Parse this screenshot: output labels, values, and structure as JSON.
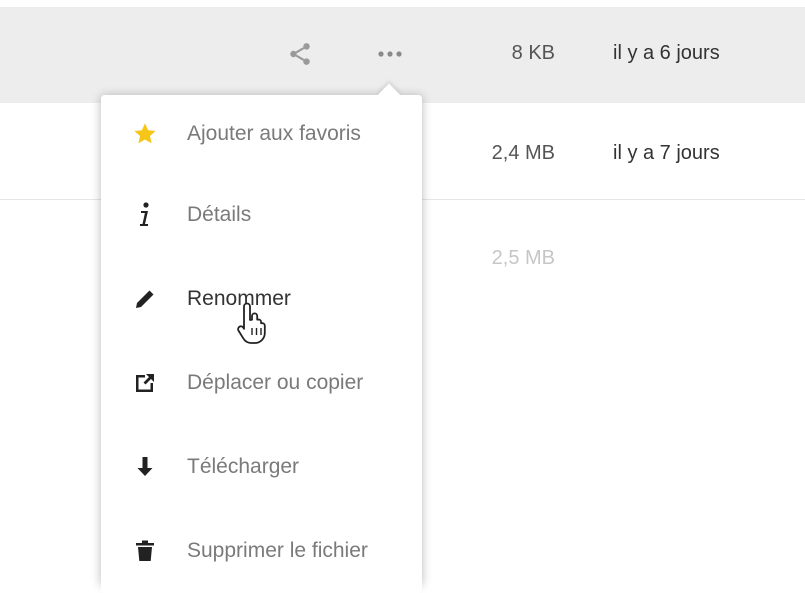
{
  "rows": [
    {
      "size": "8 KB",
      "date": "il y a 6 jours"
    },
    {
      "size": "2,4 MB",
      "date": "il y a 7 jours"
    },
    {
      "size": "2,5 MB"
    }
  ],
  "row_actions": {
    "share_icon": "share-icon",
    "more_icon": "more-horizontal-icon"
  },
  "menu": {
    "items": [
      {
        "label": "Ajouter aux favoris",
        "icon": "star-icon"
      },
      {
        "label": "Détails",
        "icon": "info-icon"
      },
      {
        "label": "Renommer",
        "icon": "pencil-icon"
      },
      {
        "label": "Déplacer ou copier",
        "icon": "external-link-icon"
      },
      {
        "label": "Télécharger",
        "icon": "download-icon"
      },
      {
        "label": "Supprimer le fichier",
        "icon": "trash-icon"
      }
    ],
    "hovered_item": "Renommer"
  },
  "colors": {
    "star": "#f5c518",
    "row_hover": "#ededed",
    "icon": "#222222",
    "label": "#7a7a7a"
  }
}
